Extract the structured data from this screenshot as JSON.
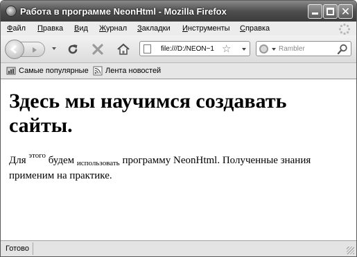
{
  "window": {
    "title": "Работа в программе NeonHtml - Mozilla Firefox",
    "close_glyph": "✕"
  },
  "menu": {
    "file": {
      "accel": "Ф",
      "rest": "айл"
    },
    "edit": {
      "accel": "П",
      "rest": "равка"
    },
    "view": {
      "accel": "В",
      "rest": "ид"
    },
    "history": {
      "accel": "Ж",
      "rest": "урнал"
    },
    "bookmarks": {
      "accel": "З",
      "rest": "акладки"
    },
    "tools": {
      "accel": "И",
      "rest": "нструменты"
    },
    "help": {
      "accel": "С",
      "rest": "правка"
    }
  },
  "navigation": {
    "url": "file:///D:/NEON~1",
    "star_glyph": "☆",
    "search_placeholder": "Rambler"
  },
  "bookmarks_toolbar": {
    "most_visited": "Самые популярные",
    "news_feed": "Лента новостей"
  },
  "content": {
    "heading": "Здесь мы научимся создавать сайты.",
    "p_1": "Для ",
    "p_sup": "этого",
    "p_2": " будем ",
    "p_sub": "использовать",
    "p_3": " программу NeonHtml. Полученные знания применим на практике."
  },
  "status": {
    "text": "Готово"
  }
}
